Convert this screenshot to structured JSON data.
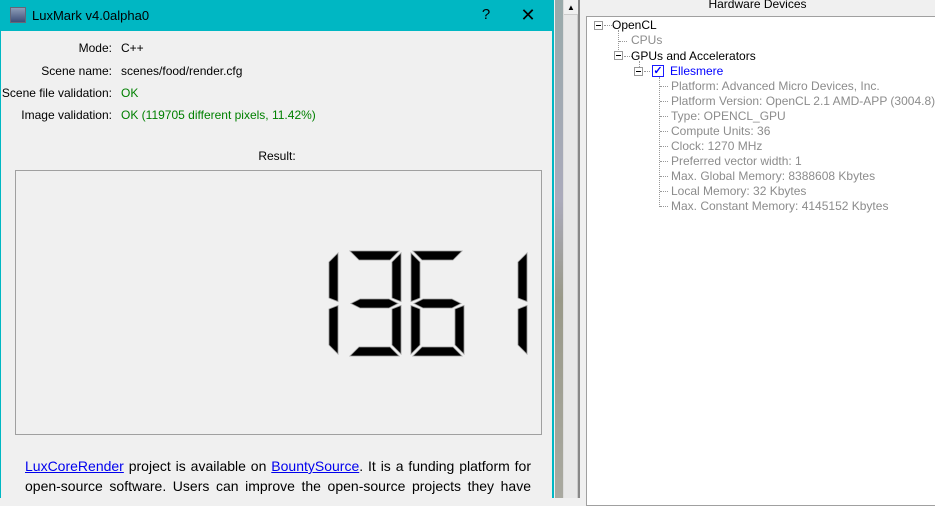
{
  "window": {
    "title": "LuxMark v4.0alpha0",
    "help_label": "?",
    "close_label": "✕"
  },
  "info": [
    {
      "label": "Mode:",
      "value": "C++",
      "status": "normal"
    },
    {
      "label": "Scene name:",
      "value": "scenes/food/render.cfg",
      "status": "normal"
    },
    {
      "label": "Scene file validation:",
      "value": "OK",
      "status": "ok"
    },
    {
      "label": "Image validation:",
      "value": "OK (119705 different pixels, 11.42%)",
      "status": "ok"
    }
  ],
  "result": {
    "label": "Result:",
    "score": "1361"
  },
  "paragraph": {
    "link1": "LuxCoreRender",
    "text1": " project is available on ",
    "link2": "BountySource",
    "text2": ". It is a funding platform for open-source software. Users can improve the open-source projects they have chosen by voting/collecting donations and bounties. Check"
  },
  "hardware": {
    "title": "Hardware Devices",
    "opencl": "OpenCL",
    "cpus": "CPUs",
    "gpus": "GPUs and Accelerators",
    "device": "Ellesmere",
    "device_checked": true,
    "props": [
      "Platform: Advanced Micro Devices, Inc.",
      "Platform Version: OpenCL 2.1 AMD-APP (3004.8)",
      "Type: OPENCL_GPU",
      "Compute Units: 36",
      "Clock: 1270 MHz",
      "Preferred vector width: 1",
      "Max. Global Memory: 8388608 Kbytes",
      "Local Memory: 32 Kbytes",
      "Max. Constant Memory: 4145152 Kbytes"
    ]
  },
  "colors": {
    "titlebar": "#00b7c3",
    "ok": "#008000",
    "link": "#0000ee"
  }
}
